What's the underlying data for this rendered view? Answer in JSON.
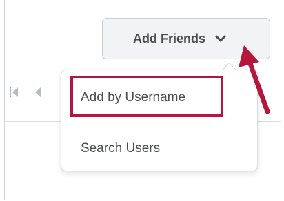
{
  "header": {
    "add_friends_label": "Add Friends"
  },
  "dropdown": {
    "items": [
      {
        "label": "Add by Username"
      },
      {
        "label": "Search Users"
      }
    ]
  },
  "colors": {
    "highlight": "#b5173c",
    "text": "#494c50",
    "button_bg": "#f1f3f5"
  },
  "icons": {
    "button_chevron": "chevron-down-icon",
    "pager_first": "first-page-icon",
    "pager_previous": "previous-page-icon",
    "callout": "arrow-icon"
  }
}
